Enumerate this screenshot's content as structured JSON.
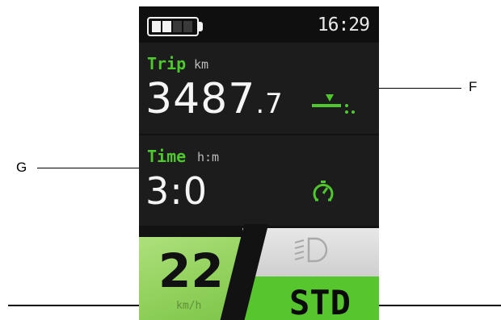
{
  "status": {
    "time": "16:29",
    "battery_level": 0.5,
    "battery_icon": "battery-icon"
  },
  "trip": {
    "title": "Trip",
    "unit": "km",
    "value_main": "3487",
    "value_decimal": ".7",
    "icon": "trip-reset-icon"
  },
  "time_panel": {
    "title": "Time",
    "unit": "h:m",
    "value": "3:0",
    "icon": "stopwatch-icon"
  },
  "speed": {
    "value": "22",
    "unit": "km/h"
  },
  "light": {
    "icon": "headlight-icon"
  },
  "mode": {
    "label": "STD"
  },
  "callouts": {
    "f": "F",
    "g": "G"
  },
  "colors": {
    "accent": "#4fc72e",
    "mode_bg": "#57c52d",
    "speed_bg": "#9bd86a",
    "screen_bg": "#121212"
  }
}
